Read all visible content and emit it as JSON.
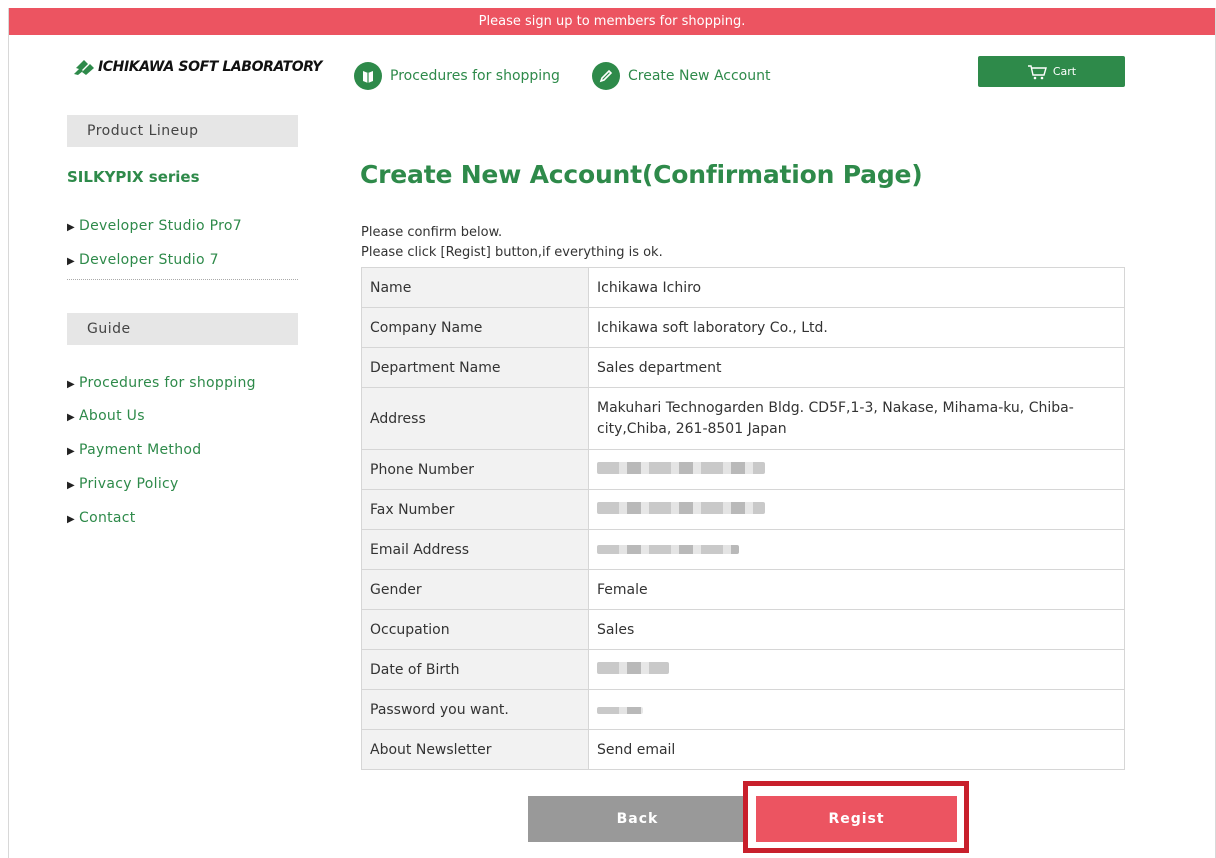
{
  "banner": {
    "text": "Please sign up to members for shopping."
  },
  "header": {
    "logo_text": "ICHIKAWA SOFT LABORATORY",
    "nav": [
      {
        "label": "Procedures for shopping",
        "icon": "book-icon"
      },
      {
        "label": "Create New Account",
        "icon": "pencil-icon"
      }
    ],
    "cart_label": "Cart"
  },
  "sidebar": {
    "product_lineup": "Product Lineup",
    "series_title": "SILKYPIX series",
    "products": [
      "Developer Studio Pro7",
      "Developer Studio 7"
    ],
    "guide": "Guide",
    "guide_links": [
      "Procedures for shopping",
      "About Us",
      "Payment Method",
      "Privacy Policy",
      "Contact"
    ]
  },
  "main": {
    "title": "Create New Account(Confirmation Page)",
    "intro_line1": "Please confirm below.",
    "intro_line2": "Please click [Regist] button,if everything is ok.",
    "rows": [
      {
        "label": "Name",
        "value": "Ichikawa Ichiro"
      },
      {
        "label": "Company Name",
        "value": "Ichikawa soft laboratory Co., Ltd."
      },
      {
        "label": "Department Name",
        "value": "Sales department"
      },
      {
        "label": "Address",
        "value": "Makuhari Technogarden Bldg. CD5F,1-3, Nakase, Mihama-ku, Chiba-city,Chiba, 261-8501 Japan"
      },
      {
        "label": "Phone Number",
        "value": ""
      },
      {
        "label": "Fax Number",
        "value": ""
      },
      {
        "label": "Email Address",
        "value": ""
      },
      {
        "label": "Gender",
        "value": "Female"
      },
      {
        "label": "Occupation",
        "value": "Sales"
      },
      {
        "label": "Date of Birth",
        "value": ""
      },
      {
        "label": "Password you want.",
        "value": ""
      },
      {
        "label": "About Newsletter",
        "value": "Send email"
      }
    ],
    "back_label": "Back",
    "regist_label": "Regist"
  },
  "colors": {
    "accent": "#2e8a4a",
    "banner": "#ec5461",
    "highlight": "#c8202c"
  }
}
